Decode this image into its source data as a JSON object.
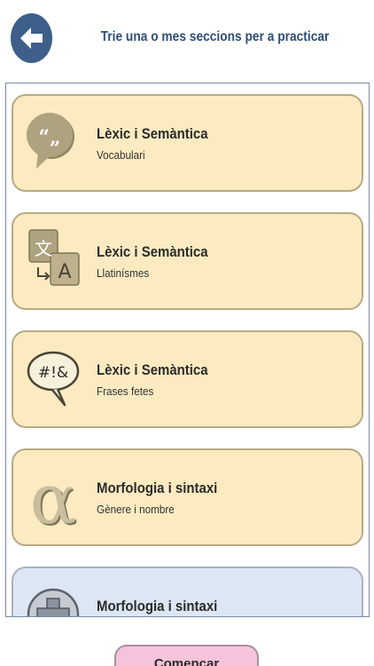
{
  "header": {
    "title": "Trie una o mes seccions per a practicar"
  },
  "sections": [
    {
      "title": "Lèxic i Semàntica",
      "subtitle": "Vocabulari",
      "icon": "quote-bubble-icon",
      "color": "#fcebc1"
    },
    {
      "title": "Lèxic i Semàntica",
      "subtitle": "Llatinísmes",
      "icon": "translate-icon",
      "color": "#fcebc1"
    },
    {
      "title": "Lèxic i Semàntica",
      "subtitle": "Frases fetes",
      "icon": "exclamation-bubble-icon",
      "color": "#fcebc1"
    },
    {
      "title": "Morfologia i sintaxi",
      "subtitle": "Gènere i nombre",
      "icon": "alpha-icon",
      "color": "#fcebc1"
    },
    {
      "title": "Morfologia i sintaxi",
      "subtitle": "",
      "icon": "plus-circle-icon",
      "color": "#dde6f3"
    }
  ],
  "icon_glyphs": {
    "quote": "“„",
    "translate_a": "文",
    "translate_b": "A",
    "exclamation": "#!&",
    "alpha": "α",
    "plus": "+"
  },
  "footer": {
    "start_label": "Començar"
  },
  "colors": {
    "accent": "#3d5f8a",
    "title_text": "#2e4f78",
    "card_beige": "#fcebc1",
    "card_blue": "#dde6f3",
    "start_button": "#f6c3dc"
  }
}
